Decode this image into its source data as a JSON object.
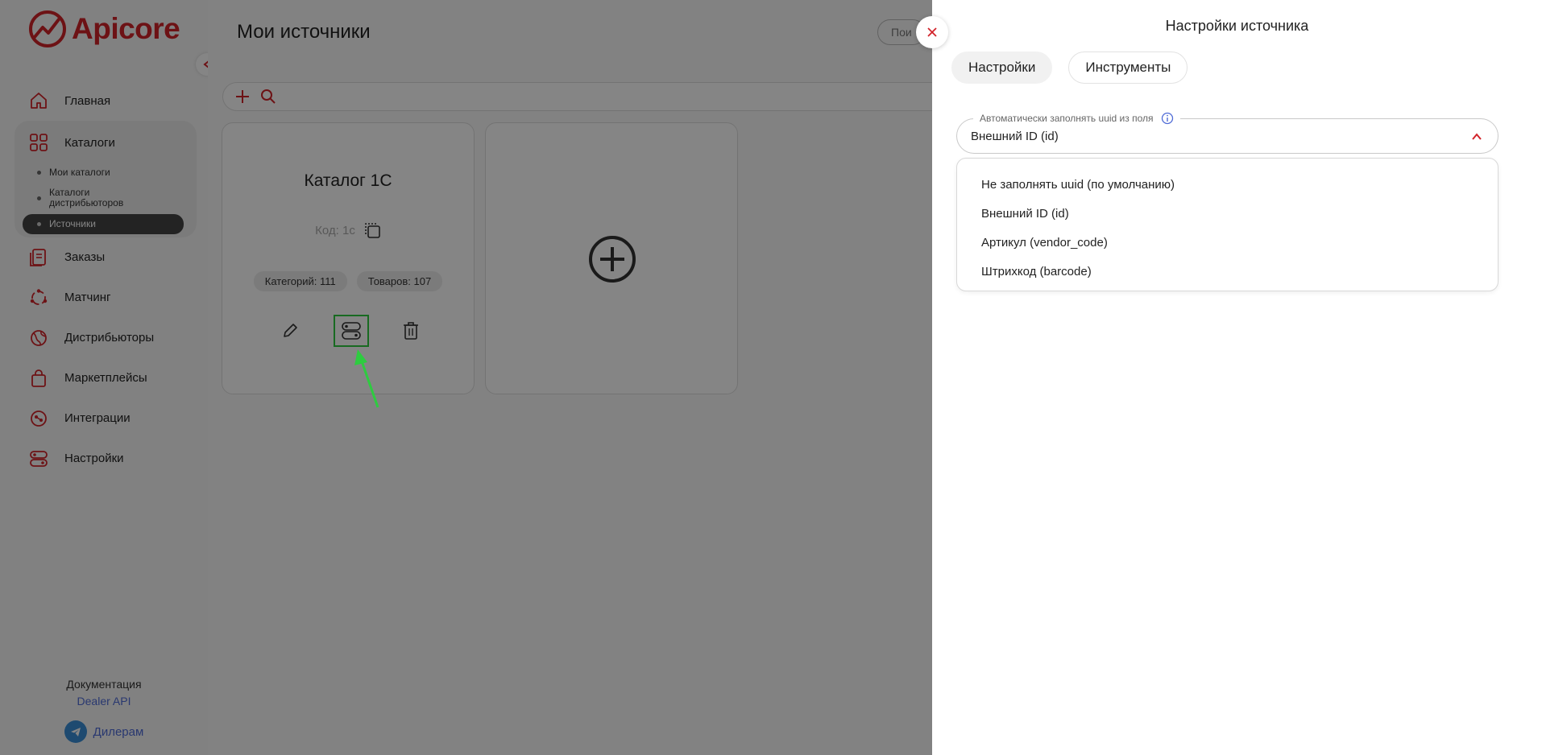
{
  "brand": {
    "name": "Apicore",
    "color": "#d2232a"
  },
  "sidebar": {
    "items": [
      {
        "label": "Главная",
        "icon": "home-icon"
      },
      {
        "label": "Каталоги",
        "icon": "grid-icon"
      },
      {
        "label": "Заказы",
        "icon": "orders-icon"
      },
      {
        "label": "Матчинг",
        "icon": "matching-icon"
      },
      {
        "label": "Дистрибьюторы",
        "icon": "globe-icon"
      },
      {
        "label": "Маркетплейсы",
        "icon": "bag-icon"
      },
      {
        "label": "Интеграции",
        "icon": "integration-icon"
      },
      {
        "label": "Настройки",
        "icon": "settings-icon"
      }
    ],
    "catalog_subitems": [
      {
        "label": "Мои каталоги"
      },
      {
        "label": "Каталоги дистрибьюторов"
      },
      {
        "label": "Источники",
        "active": true
      }
    ],
    "footer": {
      "doc_label": "Документация",
      "doc_link": "Dealer API",
      "telegram_label": "Дилерам"
    }
  },
  "main": {
    "title": "Мои источники",
    "search_placeholder": "Пои",
    "card": {
      "title": "Каталог 1С",
      "code": "Код: 1c",
      "categories": "Категорий: 111",
      "products": "Товаров: 107"
    }
  },
  "drawer": {
    "title": "Настройки источника",
    "tabs": [
      {
        "label": "Настройки",
        "active": true
      },
      {
        "label": "Инструменты",
        "active": false
      }
    ],
    "field": {
      "label": "Автоматически заполнять uuid из поля",
      "value": "Внешний ID (id)"
    },
    "options": [
      "Не заполнять uuid (по умолчанию)",
      "Внешний ID (id)",
      "Артикул (vendor_code)",
      "Штрихкод (barcode)"
    ]
  },
  "colors": {
    "accent": "#d2232a",
    "highlight": "#2ecc40",
    "link": "#4f6bd6"
  }
}
